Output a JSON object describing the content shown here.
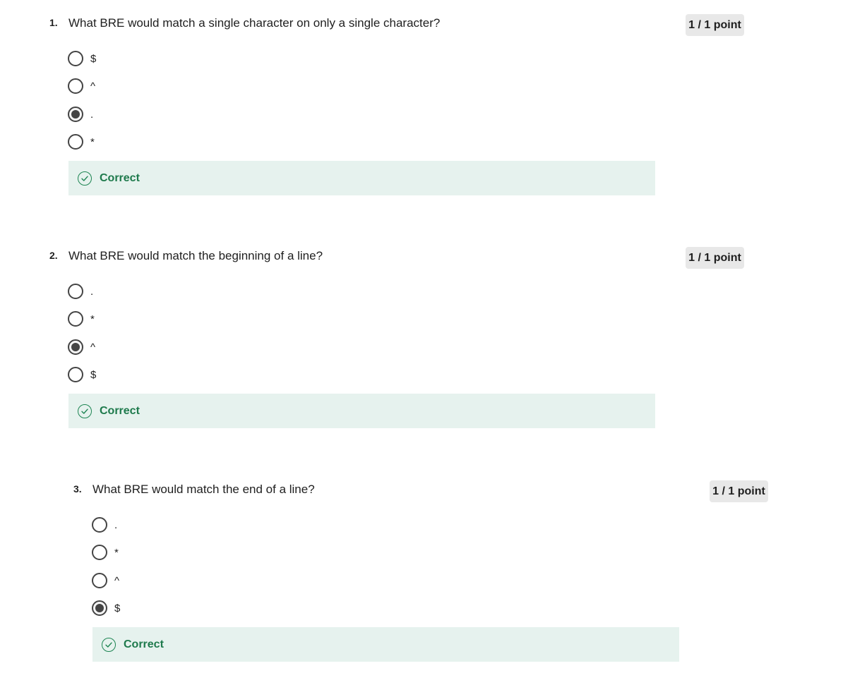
{
  "questions": [
    {
      "number": "1.",
      "text": "What BRE would match a single character on only a single character?",
      "points": "1 / 1 point",
      "options": [
        {
          "label": "$",
          "selected": false
        },
        {
          "label": "^",
          "selected": false
        },
        {
          "label": ".",
          "selected": true
        },
        {
          "label": "*",
          "selected": false
        }
      ],
      "feedback": "Correct"
    },
    {
      "number": "2.",
      "text": "What BRE would match the beginning of a line?",
      "points": "1 / 1 point",
      "options": [
        {
          "label": ".",
          "selected": false
        },
        {
          "label": "*",
          "selected": false
        },
        {
          "label": "^",
          "selected": true
        },
        {
          "label": "$",
          "selected": false
        }
      ],
      "feedback": "Correct"
    },
    {
      "number": "3.",
      "text": "What BRE would match the end of a line?",
      "points": "1 / 1 point",
      "options": [
        {
          "label": ".",
          "selected": false
        },
        {
          "label": "*",
          "selected": false
        },
        {
          "label": "^",
          "selected": false
        },
        {
          "label": "$",
          "selected": true
        }
      ],
      "feedback": "Correct"
    }
  ],
  "colors": {
    "feedback_bg": "#e6f2ee",
    "correct_text": "#1e7a4c",
    "points_badge_bg": "#e8e8e8"
  },
  "icons": {
    "feedback": "check-circle-icon"
  }
}
